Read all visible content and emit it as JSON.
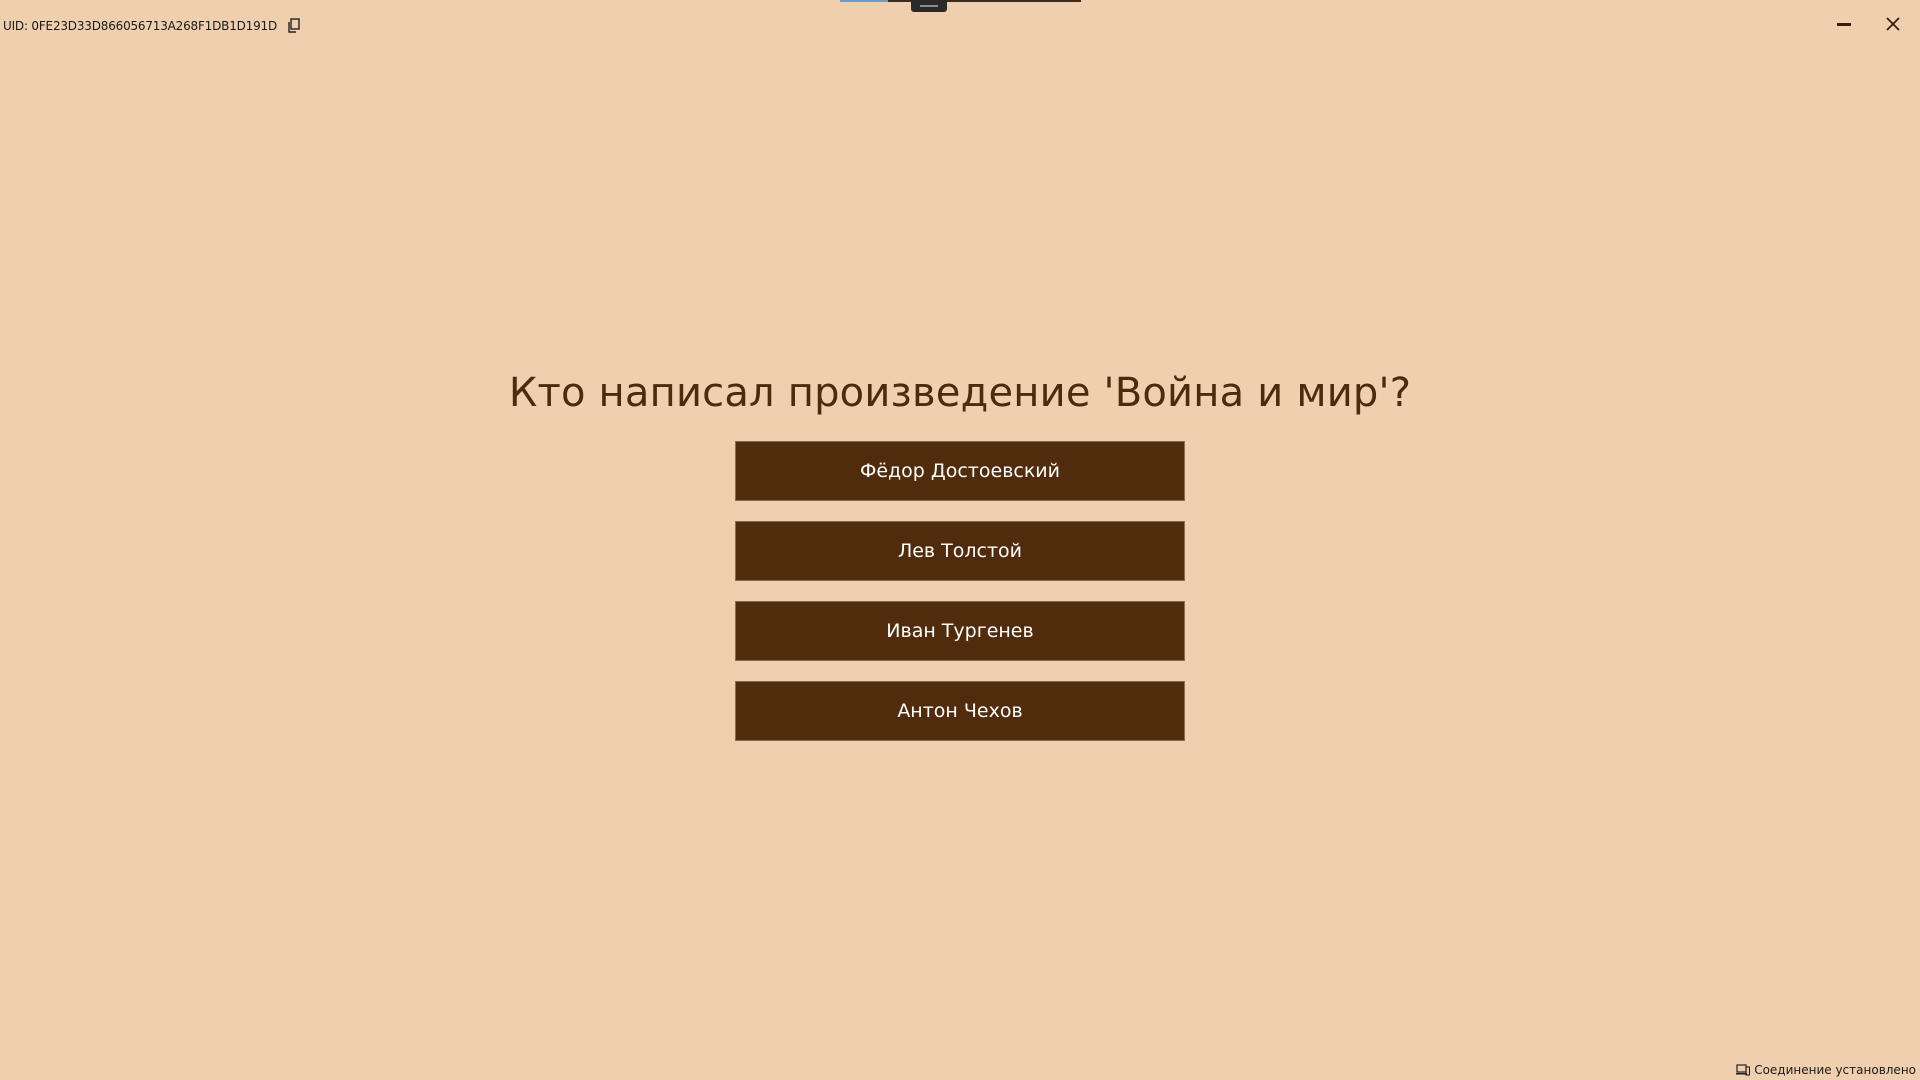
{
  "header": {
    "uid_text": "UID: 0FE23D33D866056713A268F1DB1D191D",
    "copy_icon": "copy-icon"
  },
  "window_controls": {
    "minimize_icon": "minimize-icon",
    "close_icon": "close-icon"
  },
  "quiz": {
    "question": "Кто написал произведение 'Война и мир'?",
    "answers": [
      {
        "label": "Фёдор Достоевский"
      },
      {
        "label": "Лев Толстой"
      },
      {
        "label": "Иван Тургенев"
      },
      {
        "label": "Антон Чехов"
      }
    ]
  },
  "status": {
    "icon": "devices-icon",
    "text": "Соединение установлено"
  },
  "colors": {
    "background": "#f0cfae",
    "question_text": "#4e2a0c",
    "button_bg": "#512c0c",
    "button_text": "#ffffff"
  }
}
